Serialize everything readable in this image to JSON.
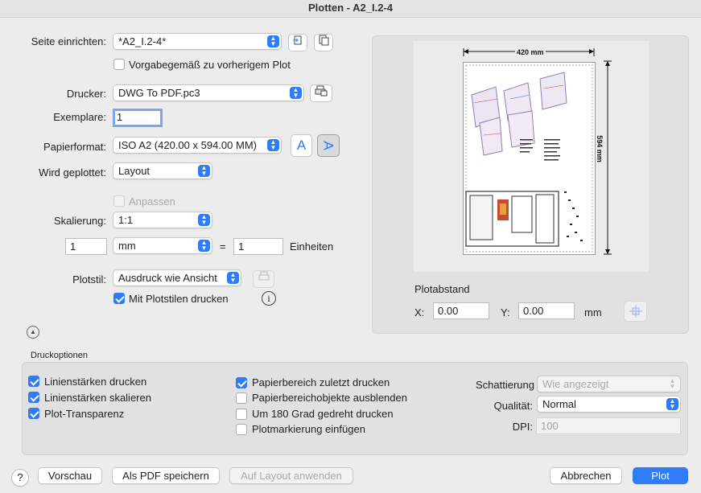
{
  "window": {
    "title": "Plotten - A2_I.2-4"
  },
  "page_setup": {
    "label": "Seite einrichten:",
    "value": "*A2_I.2-4*",
    "use_previous_label": "Vorgabegemäß zu vorherigem Plot",
    "use_previous_checked": false
  },
  "printer": {
    "label": "Drucker:",
    "value": "DWG To PDF.pc3"
  },
  "copies": {
    "label": "Exemplare:",
    "value": "1"
  },
  "paper": {
    "label": "Papierformat:",
    "value": "ISO A2 (420.00 x 594.00 MM)",
    "portrait_glyph": "A",
    "landscape_glyph": "A"
  },
  "plot_area": {
    "label": "Wird geplottet:",
    "value": "Layout"
  },
  "fit": {
    "label": "Anpassen",
    "checked": false
  },
  "scale": {
    "label": "Skalierung:",
    "value": "1:1",
    "left_value": "1",
    "unit": "mm",
    "equals": "=",
    "right_value": "1",
    "units_label": "Einheiten"
  },
  "plot_style": {
    "label": "Plotstil:",
    "value": "Ausdruck wie Ansicht",
    "with_styles_label": "Mit Plotstilen drucken",
    "with_styles_checked": true,
    "info_glyph": "i"
  },
  "preview": {
    "width_label": "420 mm",
    "height_label": "594 mm"
  },
  "offset": {
    "title": "Plotabstand",
    "x_label": "X:",
    "x_value": "0.00",
    "y_label": "Y:",
    "y_value": "0.00",
    "unit": "mm"
  },
  "options": {
    "title": "Druckoptionen",
    "col1": [
      {
        "label": "Linienstärken drucken",
        "checked": true
      },
      {
        "label": "Linienstärken skalieren",
        "checked": true
      },
      {
        "label": "Plot-Transparenz",
        "checked": true
      }
    ],
    "col2": [
      {
        "label": "Papierbereich zuletzt drucken",
        "checked": true
      },
      {
        "label": "Papierbereichobjekte ausblenden",
        "checked": false
      },
      {
        "label": "Um 180 Grad gedreht drucken",
        "checked": false
      },
      {
        "label": "Plotmarkierung einfügen",
        "checked": false
      }
    ],
    "shading_label": "Schattierung",
    "shading_value": "Wie angezeigt",
    "quality_label": "Qualität:",
    "quality_value": "Normal",
    "dpi_label": "DPI:",
    "dpi_value": "100"
  },
  "footer": {
    "help": "?",
    "preview": "Vorschau",
    "save_pdf": "Als PDF speichern",
    "apply_layout": "Auf Layout anwenden",
    "cancel": "Abbrechen",
    "plot": "Plot"
  },
  "colors": {
    "accent": "#2f7cf6"
  }
}
